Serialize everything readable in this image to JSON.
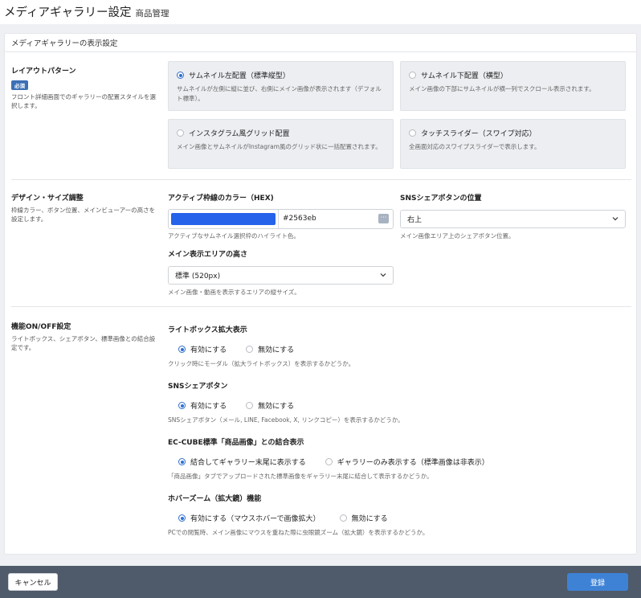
{
  "header": {
    "title": "メディアギャラリー設定",
    "subtitle": "商品管理"
  },
  "card": {
    "title": "メディアギャラリーの表示設定"
  },
  "layout_section": {
    "title": "レイアウトパターン",
    "badge": "必須",
    "desc": "フロント詳細画面でのギャラリーの配置スタイルを選択します。",
    "options": [
      {
        "label": "サムネイル左配置（標準縦型）",
        "desc": "サムネイルが左側に縦に並び、右側にメイン画像が表示されます（デフォルト標準）。",
        "selected": true
      },
      {
        "label": "サムネイル下配置（横型）",
        "desc": "メイン画像の下部にサムネイルが横一列でスクロール表示されます。",
        "selected": false
      },
      {
        "label": "インスタグラム風グリッド配置",
        "desc": "メイン画像とサムネイルがInstagram風のグリッド状に一括配置されます。",
        "selected": false
      },
      {
        "label": "タッチスライダー（スワイプ対応）",
        "desc": "全画面対応のスワイプスライダーで表示します。",
        "selected": false
      }
    ]
  },
  "design_section": {
    "title": "デザイン・サイズ調整",
    "desc": "枠線カラー、ボタン位置、メインビューアーの高さを設定します。",
    "color_field": {
      "label": "アクティブ枠線のカラー（HEX)",
      "value": "#2563eb",
      "help": "アクティブなサムネイル選択枠のハイライト色。",
      "swatch_color": "#2563eb"
    },
    "sns_position": {
      "label": "SNSシェアボタンの位置",
      "value": "右上",
      "help": "メイン画像エリア上のシェアボタン位置。"
    },
    "main_height": {
      "label": "メイン表示エリアの高さ",
      "value": "標準 (520px)",
      "help": "メイン画像・動画を表示するエリアの縦サイズ。"
    }
  },
  "feature_section": {
    "title": "機能ON/OFF設定",
    "desc": "ライトボックス、シェアボタン、標準画像との結合設定です。",
    "lightbox": {
      "label": "ライトボックス拡大表示",
      "on": "有効にする",
      "off": "無効にする",
      "selected": "on",
      "help": "クリック時にモーダル（拡大ライトボックス）を表示するかどうか。"
    },
    "sns": {
      "label": "SNSシェアボタン",
      "on": "有効にする",
      "off": "無効にする",
      "selected": "on",
      "help": "SNSシェアボタン（メール, LINE, Facebook, X, リンクコピー）を表示するかどうか。"
    },
    "merge": {
      "label": "EC-CUBE標準「商品画像」との結合表示",
      "on": "結合してギャラリー末尾に表示する",
      "off": "ギャラリーのみ表示する（標準画像は非表示）",
      "selected": "on",
      "help": "「商品画像」タブでアップロードされた標準画像をギャラリー末尾に結合して表示するかどうか。"
    },
    "hover": {
      "label": "ホバーズーム（拡大鏡）機能",
      "on": "有効にする（マウスホバーで画像拡大）",
      "off": "無効にする",
      "selected": "on",
      "help": "PCでの閲覧時、メイン画像にマウスを重ねた際に虫眼鏡ズーム（拡大鏡）を表示するかどうか。"
    }
  },
  "footer": {
    "cancel": "キャンセル",
    "save": "登録"
  },
  "colors": {
    "accent": "#3e82d6",
    "footer_bg": "#4f5b6a"
  }
}
